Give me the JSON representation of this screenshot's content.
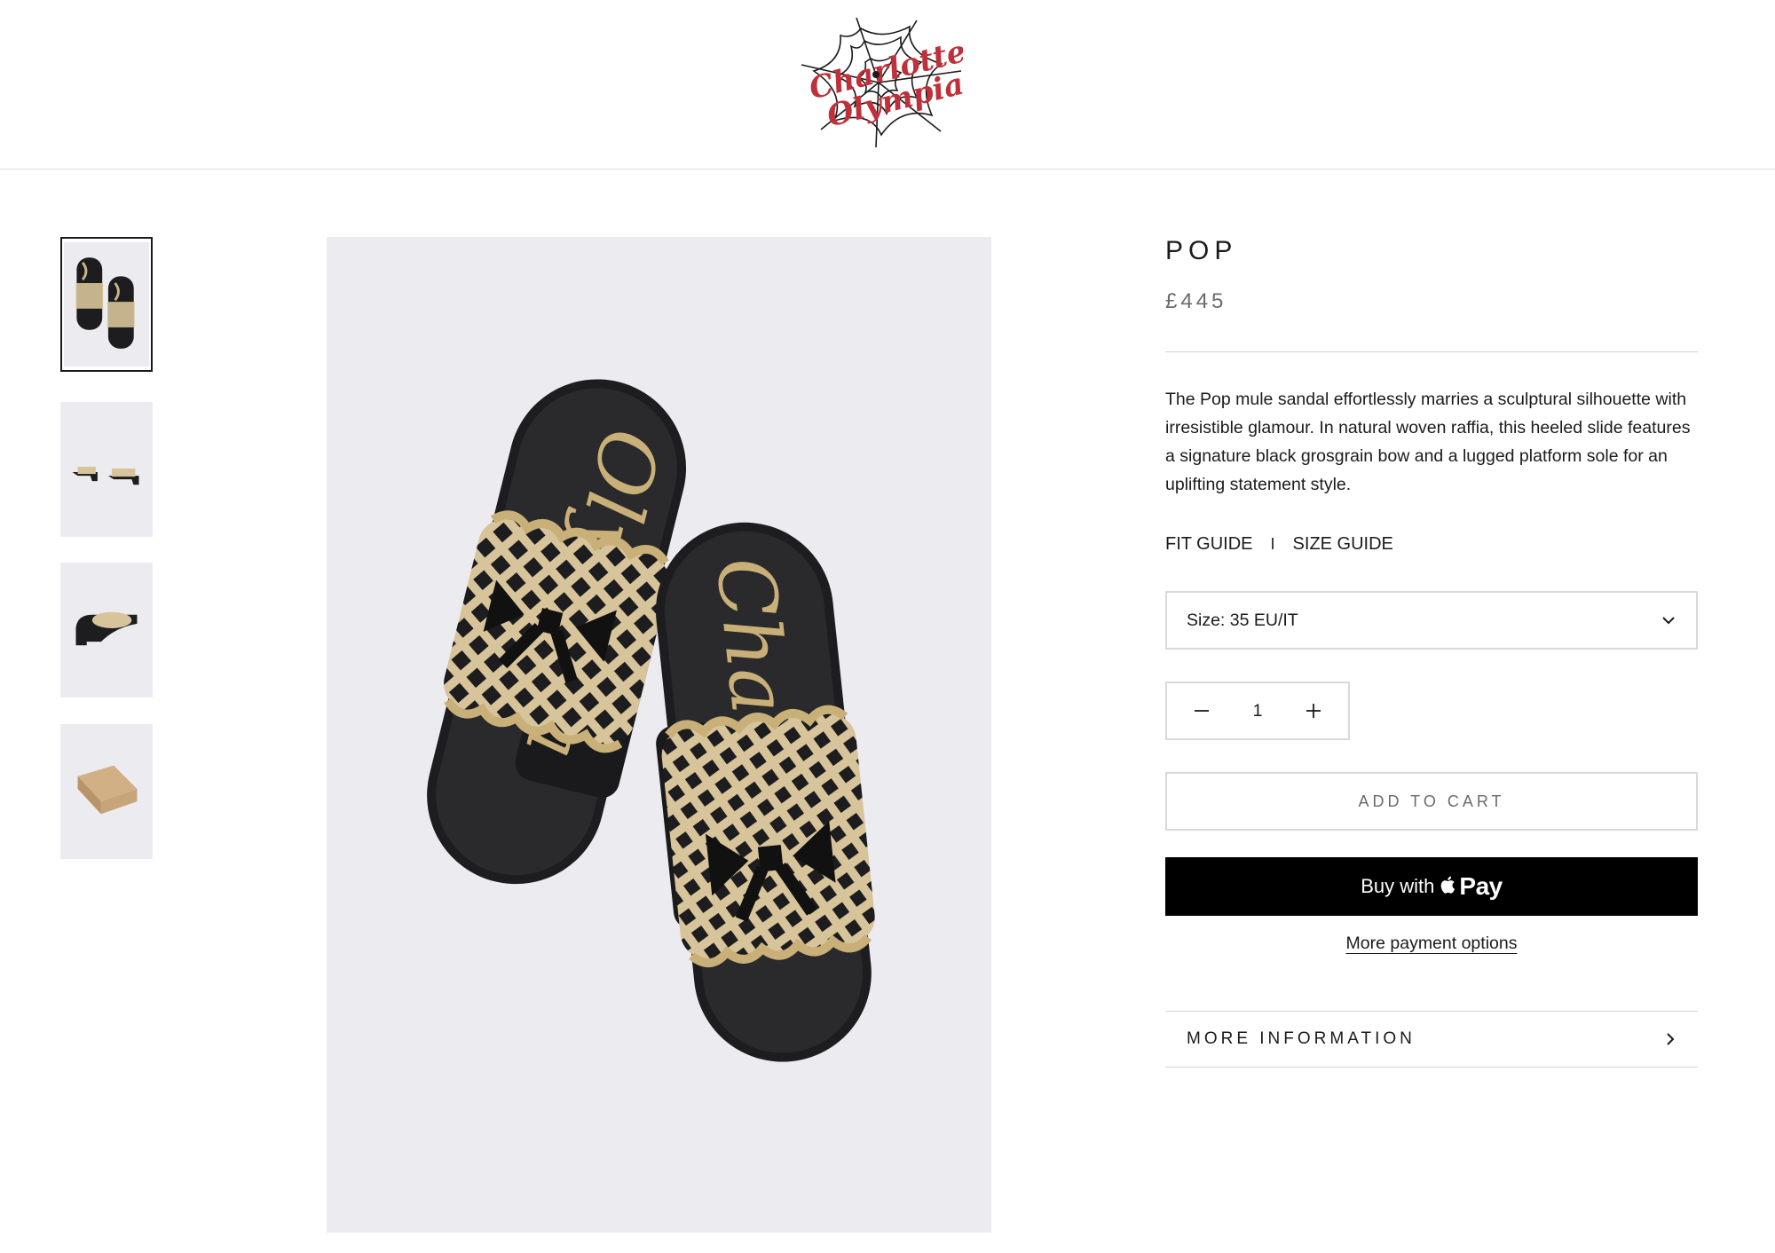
{
  "header": {
    "logo_line1": "Charlotte",
    "logo_line2": "Olympia",
    "logo_icon": "spider-web-icon"
  },
  "gallery": {
    "thumbnails": [
      {
        "name": "thumb-top-view",
        "active": true
      },
      {
        "name": "thumb-side-view-pair",
        "active": false
      },
      {
        "name": "thumb-side-view-single",
        "active": false
      },
      {
        "name": "thumb-box",
        "active": false
      }
    ],
    "insole_text_left": "Olympia",
    "insole_text_right": "Charlotte"
  },
  "product": {
    "title": "POP",
    "price": "£445",
    "description": "The Pop mule sandal effortlessly marries a sculptural silhouette with irresistible glamour. In natural woven raffia, this heeled slide features a signature black grosgrain bow and a lugged platform sole for an uplifting statement style.",
    "fit_guide": "FIT GUIDE",
    "guide_separator": "I",
    "size_guide": "SIZE GUIDE",
    "size_select": "Size: 35 EU/IT",
    "quantity": "1",
    "add_to_cart": "ADD TO CART",
    "buy_with": "Buy with",
    "apple_pay_word": "Pay",
    "more_payment": "More payment options",
    "more_information": "MORE INFORMATION"
  },
  "colors": {
    "text": "#1c1b1b",
    "muted": "#6b6b6b",
    "border": "#d9d9d9",
    "logo_red": "#c0303a",
    "buy_button": "#000000",
    "raffia": "#d8c49a",
    "sole": "#1d1d1f"
  }
}
